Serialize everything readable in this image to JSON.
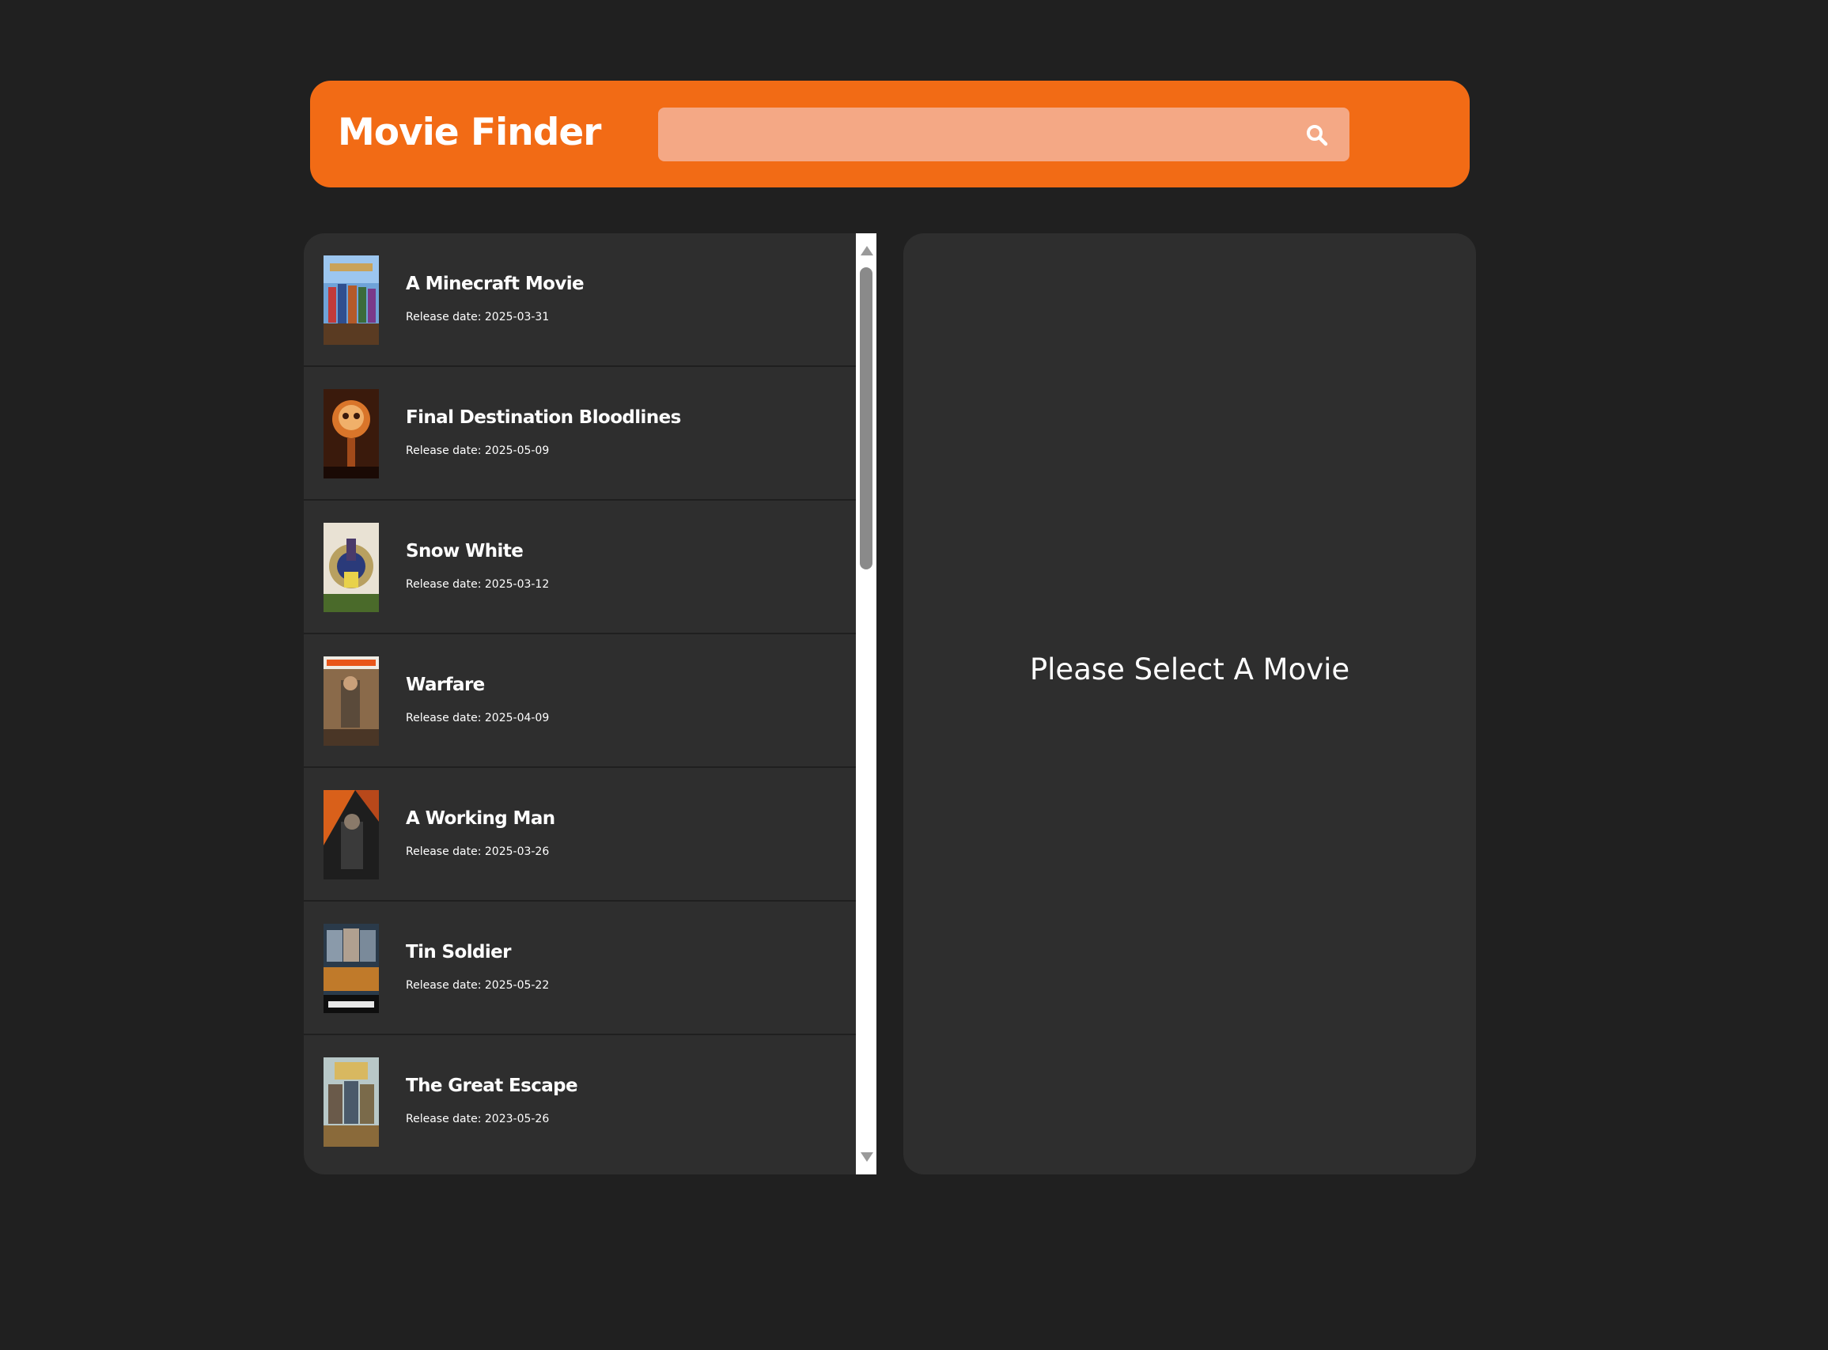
{
  "header": {
    "title": "Movie Finder",
    "search": {
      "placeholder": "",
      "value": "",
      "icon": "search-icon"
    }
  },
  "movies": [
    {
      "title": "A Minecraft Movie",
      "release": "Release date: 2025-03-31"
    },
    {
      "title": "Final Destination Bloodlines",
      "release": "Release date: 2025-05-09"
    },
    {
      "title": "Snow White",
      "release": "Release date: 2025-03-12"
    },
    {
      "title": "Warfare",
      "release": "Release date: 2025-04-09"
    },
    {
      "title": "A Working Man",
      "release": "Release date: 2025-03-26"
    },
    {
      "title": "Tin Soldier",
      "release": "Release date: 2025-05-22"
    },
    {
      "title": "The Great Escape",
      "release": "Release date: 2023-05-26"
    }
  ],
  "detail": {
    "placeholder": "Please Select A Movie"
  },
  "colors": {
    "background": "#202020",
    "accent": "#f26b15",
    "search_bg": "#f4a885",
    "panel": "#2e2e2e",
    "text": "#ffffff"
  }
}
